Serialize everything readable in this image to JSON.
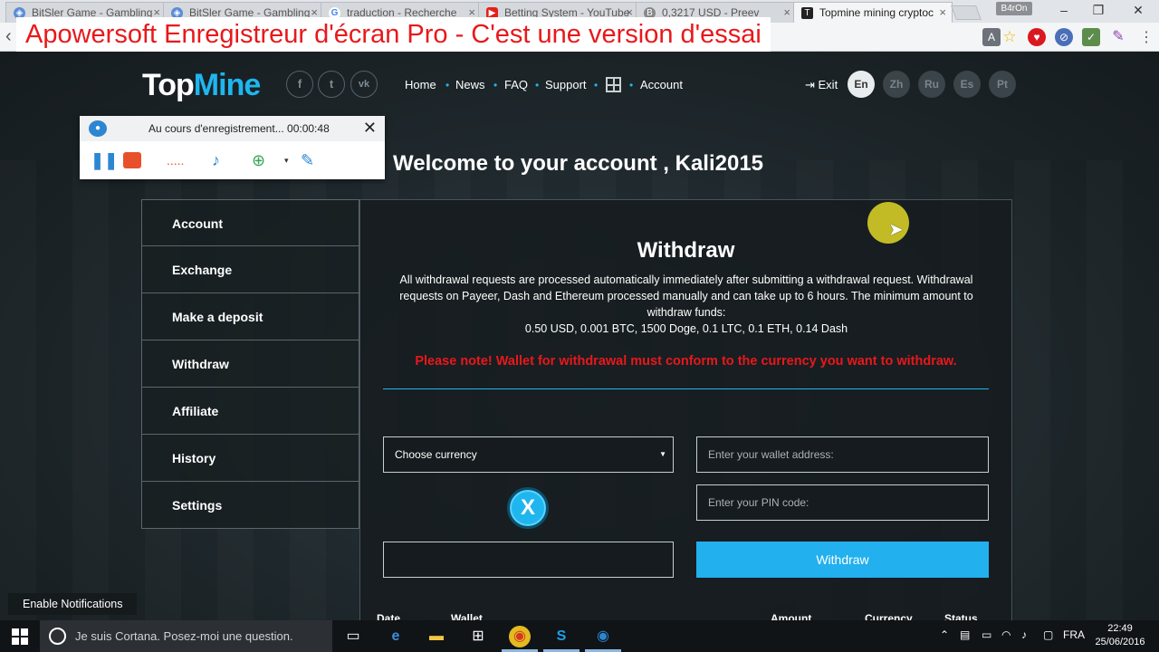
{
  "browser": {
    "tabs": [
      {
        "title": "BitSler Game - Gambling",
        "favicon": "bitsler-icon"
      },
      {
        "title": "BitSler Game - Gambling",
        "favicon": "bitsler-icon"
      },
      {
        "title": "traduction - Recherche",
        "favicon": "google-icon"
      },
      {
        "title": "Betting System - YouTube",
        "favicon": "youtube-icon"
      },
      {
        "title": "0,3217 USD - Preev",
        "favicon": "bitcoin-icon"
      },
      {
        "title": "Topmine mining cryptoc",
        "favicon": "topmine-icon"
      }
    ],
    "profile_label": "B4rOn",
    "window_controls": {
      "minimize": "–",
      "restore": "❐",
      "close": "✕"
    }
  },
  "watermark": "Apowersoft Enregistreur d'écran Pro - C'est une version d'essai",
  "site": {
    "logo_part1": "Top",
    "logo_part2": "Mine",
    "social": [
      "f",
      "t",
      "vk"
    ],
    "nav": [
      "Home",
      "News",
      "FAQ",
      "Support",
      "Account"
    ],
    "exit_label": "Exit",
    "languages": [
      "En",
      "Zh",
      "Ru",
      "Es",
      "Pt"
    ],
    "active_language": "En"
  },
  "recorder": {
    "status": "Au cours d'enregistrement... 00:00:48"
  },
  "welcome": "Welcome to your account , Kali2015",
  "sidebar": [
    "Account",
    "Exchange",
    "Make a deposit",
    "Withdraw",
    "Affiliate",
    "History",
    "Settings"
  ],
  "withdraw": {
    "title": "Withdraw",
    "description": "All withdrawal requests are processed automatically immediately after submitting a withdrawal request. Withdrawal requests on Payeer, Dash and Ethereum processed manually and can take up to 6 hours. The minimum amount to withdraw funds:",
    "minimums": "0.50 USD, 0.001 BTC, 1500 Doge, 0.1 LTC, 0.1 ETH, 0.14 Dash",
    "note": "Please note! Wallet for withdrawal must conform to the currency you want to withdraw.",
    "currency_select": "Choose currency",
    "wallet_placeholder": "Enter your wallet address:",
    "pin_placeholder": "Enter your PIN code:",
    "amount_value": "",
    "coin_symbol": "X",
    "button": "Withdraw",
    "table_headers": [
      "Date",
      "Wallet",
      "Amount",
      "Currency",
      "Status"
    ]
  },
  "notification": "Enable Notifications",
  "taskbar": {
    "cortana": "Je suis Cortana. Posez-moi une question.",
    "language": "FRA",
    "time": "22:49",
    "date": "25/06/2016"
  },
  "colors": {
    "accent": "#1fb6ef",
    "warning": "#e8181b",
    "highlight": "#e1d728"
  }
}
